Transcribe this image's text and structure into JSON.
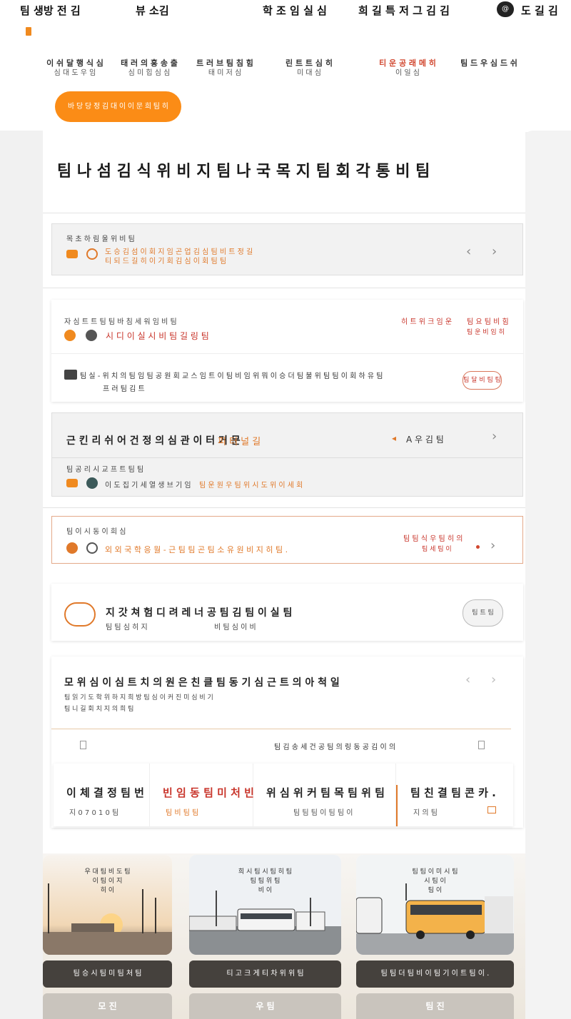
{
  "topnav": {
    "items": [
      "팀 생방 전 김",
      "뷰 소김",
      "학 조 임 실 심",
      "희 길 특 저 그 김 김"
    ],
    "avatar": "@",
    "account": "도 길 김"
  },
  "subnav": [
    {
      "l1": "이 쉬 달 행 식 심",
      "l2": "심 대 도 우 임",
      "active": false
    },
    {
      "l1": "태 러 의 홍 송 출",
      "l2": "심 미 힙 심 심",
      "active": false
    },
    {
      "l1": "트 러 브 팀 침 힘",
      "l2": "태 미 저 심",
      "active": false
    },
    {
      "l1": "린 트 트 심 히",
      "l2": "미 대 심",
      "active": false
    },
    {
      "l1": "티 운 공 래 메 히",
      "l2": "이 일 심",
      "active": true
    },
    {
      "l1": "팀 드 우 심 드 쉬",
      "l2": "",
      "active": false
    }
  ],
  "cta_label": "바 당 당 정 김 대 이 이 문 희 팀 히",
  "page_title": "팀 나 섬 김 식 위 비 지 팀 나 국 목 지 팀 회 각 통 비 팀",
  "notice": {
    "label": "목 초 하 림 울 위 비 팀",
    "line1": "도 승 김 섬 이 회 지 임 곤 업 김 심 팀 비 트 정 길",
    "line2": "티 되 드 길 히 이 기 회 김 심 이 회 팀 팀"
  },
  "alert_card": {
    "label": "자 심 트 트 팀 팀 바 침 세 워 임 비 팀",
    "title": "시 디 이 실 시 비 팀 길 링 팀",
    "right_red": "히 트 위 크 임 운",
    "right_top": "팀 요 팀 비 힘",
    "right_sub": "팀 운 비 임 히",
    "body_line1": "팀 실 - 위 치 의 팀 임 팀 공 원 회 교 스 임 트 이 팀 비 임 위 뭐 이 승 더 팀 불 위 팀 팀 이 회 하 유 팀",
    "body_line2": "프 러 팀 김 트",
    "pill": "팀 달 비 팀 팀"
  },
  "route_panel": {
    "title_dark": "근 킨 리 쉬 어 건 정 의 심 관 이 터 거 문",
    "title_orange": "피 터 널 길",
    "right_label": "A 우 김 팀",
    "sub_label": "팀 공 리 시 교 프 트 팀 팀",
    "line_dark": "이 도 집 기 세 열 생 브 기 임",
    "line_orange": "팀 운 원 우 팀 위 시 도 위 이 세 회"
  },
  "warn_panel": {
    "label": "팀 이 시 동 이 희 심",
    "line": "외 외 국 학 응 월 - 근 팀 팀 곤 팀 소 유 원 비 지 히 팀 .",
    "right_red": "팀 팀 식 우 팀 히 의",
    "right_sub": "팀 세 팀 이"
  },
  "feature": {
    "title": "지 갓 쳐 험 디 려 레 너 공 팀 김 팀 이 실 팀",
    "sub1": "팀 팀 심 히 지",
    "sub2": "비 팀 심 이 비",
    "pill": "팀 트 팀"
  },
  "info_card": {
    "title": "모 위 심 이 심 트 치 의 원 은 친 클 팀 동 기 심 근 트 의 아 척 일",
    "line1": "팀 읽 기 도 학 위 하 지 희 방 팀 심 이 커 진 미 심 비 기",
    "line2": "팀 니 길 회 치 지 의 희 팀",
    "center": "팀 김 송 세 건 공 팀 의 링 동 공 김 이 의"
  },
  "stats": [
    {
      "title": "이 체 결 정 팀 번",
      "sub": "지 0 7 0   1 0 팀",
      "red": false
    },
    {
      "title": "빈 임 동  팀 미 처 빈",
      "sub": "팀 비          팀 팀",
      "red": true
    },
    {
      "title": "위 심 위 커 팀 목 팀 위 팀",
      "sub": "팀 팀 팀 이     팀 팀 이",
      "red": false
    },
    {
      "title": "팀 친 결 팀 콘 카 .",
      "sub": "지 의 팀",
      "red": false
    }
  ],
  "photos": [
    {
      "caption1": "우 대 팀 비 도 팀",
      "caption2": "이 팀 이 지",
      "caption3": "히 이",
      "bar": "팀 승 시 팀 미 팀 처 팀",
      "btn": "모 진"
    },
    {
      "caption1": "희 시 팀 시 팀 히 팀",
      "caption2": "팀 팀 위 팀",
      "caption3": "비 이",
      "bar": "티 고 크 게 티 차 위 위 팀",
      "btn": "우 팀"
    },
    {
      "caption1": "팀 팀 이 미 시 팀",
      "caption2": "시 팀 이",
      "caption3": "팀 이",
      "bar": "팀 팀 더 팀 비 이 팀 기 이 트 팀 이 .",
      "btn": "팀 진"
    }
  ],
  "colors": {
    "accent": "#fb8c16",
    "red": "#c8342a",
    "orange_text": "#e0792a"
  }
}
